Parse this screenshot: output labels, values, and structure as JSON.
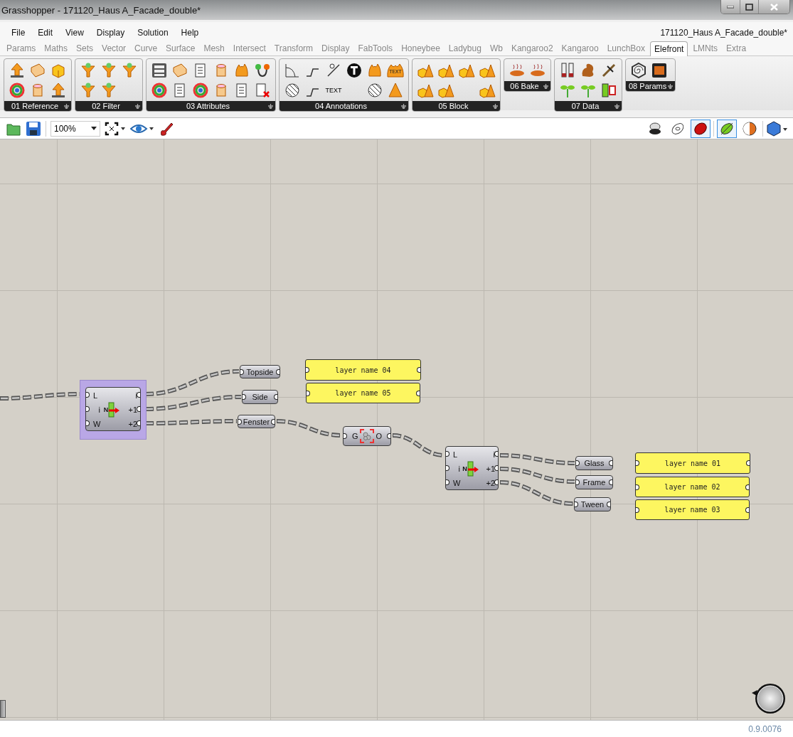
{
  "window": {
    "title": "Grasshopper - 171120_Haus A_Facade_double*"
  },
  "menu": {
    "items": [
      "File",
      "Edit",
      "View",
      "Display",
      "Solution",
      "Help"
    ],
    "document_name": "171120_Haus A_Facade_double*"
  },
  "tabs": [
    {
      "label": "Params",
      "selected": false
    },
    {
      "label": "Maths",
      "selected": false
    },
    {
      "label": "Sets",
      "selected": false
    },
    {
      "label": "Vector",
      "selected": false
    },
    {
      "label": "Curve",
      "selected": false
    },
    {
      "label": "Surface",
      "selected": false
    },
    {
      "label": "Mesh",
      "selected": false
    },
    {
      "label": "Intersect",
      "selected": false
    },
    {
      "label": "Transform",
      "selected": false
    },
    {
      "label": "Display",
      "selected": false
    },
    {
      "label": "FabTools",
      "selected": false
    },
    {
      "label": "Honeybee",
      "selected": false
    },
    {
      "label": "Ladybug",
      "selected": false
    },
    {
      "label": "Wb",
      "selected": false
    },
    {
      "label": "Kangaroo2",
      "selected": false
    },
    {
      "label": "Kangaroo",
      "selected": false
    },
    {
      "label": "LunchBox",
      "selected": false
    },
    {
      "label": "Elefront",
      "selected": true
    },
    {
      "label": "LMNts",
      "selected": false
    },
    {
      "label": "Extra",
      "selected": false
    }
  ],
  "ribbon_groups": [
    {
      "label": "01 Reference",
      "icons": [
        {
          "kind": "arrow"
        },
        {
          "kind": "slab"
        },
        {
          "kind": "cube"
        },
        {
          "kind": "wheel"
        },
        {
          "kind": "cylinder"
        },
        {
          "kind": "arrow"
        }
      ]
    },
    {
      "label": "02 Filter",
      "icons": [
        {
          "kind": "funnel"
        },
        {
          "kind": "funnel"
        },
        {
          "kind": "funnel"
        },
        {
          "kind": "funnel"
        },
        {
          "kind": "funnel"
        }
      ]
    },
    {
      "label": "03 Attributes",
      "icons": [
        {
          "kind": "layers"
        },
        {
          "kind": "slab"
        },
        {
          "kind": "doc"
        },
        {
          "kind": "cylinder"
        },
        {
          "kind": "flame"
        },
        {
          "kind": "nodes"
        },
        {
          "kind": "wheel"
        },
        {
          "kind": "doc"
        },
        {
          "kind": "wheel"
        },
        {
          "kind": "cylinder"
        },
        {
          "kind": "doc"
        },
        {
          "kind": "doc-x"
        }
      ]
    },
    {
      "label": "04 Annotations",
      "icons": [
        {
          "kind": "angle"
        },
        {
          "kind": "leader"
        },
        {
          "kind": "dim"
        },
        {
          "kind": "tee"
        },
        {
          "kind": "flame"
        },
        {
          "kind": "flame-text",
          "text": "TEXT"
        },
        {
          "kind": "hatch"
        },
        {
          "kind": "leader"
        },
        {
          "kind": "text",
          "text": "TEXT"
        },
        {
          "kind": "blank"
        },
        {
          "kind": "hatch"
        },
        {
          "kind": "cone"
        }
      ]
    },
    {
      "label": "05 Block",
      "icons": [
        {
          "kind": "cone-cube"
        },
        {
          "kind": "cone-cube"
        },
        {
          "kind": "cone-cube"
        },
        {
          "kind": "cone-cube"
        },
        {
          "kind": "cone-cube"
        },
        {
          "kind": "cone-cube"
        },
        {
          "kind": "blank"
        },
        {
          "kind": "cone-cube"
        }
      ]
    },
    {
      "label": "06 Bake",
      "icons": [
        {
          "kind": "bread"
        },
        {
          "kind": "bread"
        }
      ]
    },
    {
      "label": "07 Data",
      "icons": [
        {
          "kind": "saw"
        },
        {
          "kind": "squirrel"
        },
        {
          "kind": "wheat"
        },
        {
          "kind": "plant"
        },
        {
          "kind": "plant"
        },
        {
          "kind": "meter"
        }
      ]
    },
    {
      "label": "08 Params",
      "icons": [
        {
          "kind": "spiral"
        },
        {
          "kind": "oven"
        }
      ]
    }
  ],
  "toolbar": {
    "zoom": "100%",
    "display_modes": [
      {
        "selected": false
      },
      {
        "selected": false
      },
      {
        "selected": true
      },
      {
        "selected": true
      },
      {
        "selected": false
      }
    ]
  },
  "canvas": {
    "nodes": [
      {
        "kind": "component",
        "selected": true,
        "inputs": [
          "L",
          "i",
          "W"
        ],
        "outputs": [
          "i",
          "+1",
          "+2"
        ],
        "center_label": "N"
      },
      {
        "kind": "param",
        "label": "Topside"
      },
      {
        "kind": "param",
        "label": "Side"
      },
      {
        "kind": "param",
        "label": "Fenster"
      },
      {
        "kind": "panel",
        "text": "layer name 04"
      },
      {
        "kind": "panel",
        "text": "layer name 05"
      },
      {
        "kind": "group",
        "input": "G",
        "output": "O"
      },
      {
        "kind": "component",
        "selected": false,
        "inputs": [
          "L",
          "i",
          "W"
        ],
        "outputs": [
          "i",
          "+1",
          "+2"
        ],
        "center_label": "N"
      },
      {
        "kind": "param",
        "label": "Glass"
      },
      {
        "kind": "param",
        "label": "Frame"
      },
      {
        "kind": "param",
        "label": "Tween"
      },
      {
        "kind": "panel",
        "text": "layer name 01"
      },
      {
        "kind": "panel",
        "text": "layer name 02"
      },
      {
        "kind": "panel",
        "text": "layer name 03"
      }
    ]
  },
  "status_bar": {
    "version": "0.9.0076"
  }
}
